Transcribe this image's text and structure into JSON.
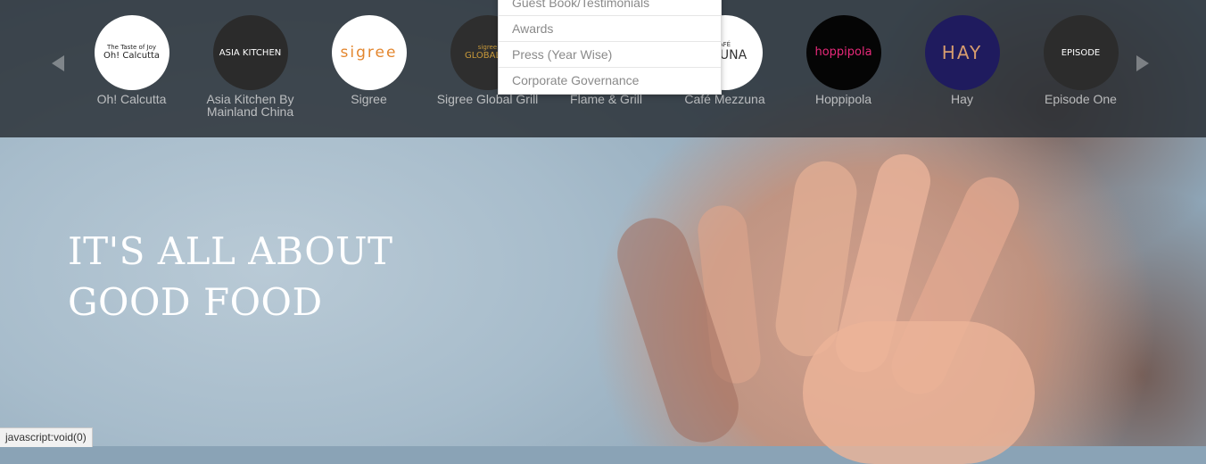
{
  "brands": [
    {
      "name": "Oh! Calcutta",
      "logo_text": "Oh! Calcutta",
      "logo_sub": "The Taste of Joy",
      "logo_bg": "#ffffff",
      "logo_fg": "#222222",
      "icon": "oh-calcutta-logo"
    },
    {
      "name": "Asia Kitchen By Mainland China",
      "logo_text": "ASIA KITCHEN",
      "logo_sub": "",
      "logo_bg": "#2b2b2b",
      "logo_fg": "#ffffff",
      "icon": "asia-kitchen-logo"
    },
    {
      "name": "Sigree",
      "logo_text": "sigree",
      "logo_sub": "",
      "logo_bg": "#ffffff",
      "logo_fg": "#e3862e",
      "icon": "sigree-logo"
    },
    {
      "name": "Sigree Global Grill",
      "logo_text": "GLOBAL G",
      "logo_sub": "sigree",
      "logo_bg": "#2e2e2e",
      "logo_fg": "#c99a3a",
      "icon": "sigree-global-grill-logo"
    },
    {
      "name": "Flame & Grill",
      "logo_text": "",
      "logo_sub": "",
      "logo_bg": "#3a3a3a",
      "logo_fg": "#ffffff",
      "icon": "flame-grill-logo"
    },
    {
      "name": "Café Mezzuna",
      "logo_text": "ZZUNA",
      "logo_sub": "AFÉ",
      "logo_bg": "#ffffff",
      "logo_fg": "#333333",
      "icon": "cafe-mezzuna-logo"
    },
    {
      "name": "Hoppipola",
      "logo_text": "hoppipola",
      "logo_sub": "",
      "logo_bg": "#050505",
      "logo_fg": "#e8297a",
      "icon": "hoppipola-logo"
    },
    {
      "name": "Hay",
      "logo_text": "HAY",
      "logo_sub": "",
      "logo_bg": "#1f1b5e",
      "logo_fg": "#d79d6e",
      "icon": "hay-logo"
    },
    {
      "name": "Episode One",
      "logo_text": "EPISODE",
      "logo_sub": "",
      "logo_bg": "#2c2c2c",
      "logo_fg": "#ffffff",
      "icon": "episode-one-logo"
    }
  ],
  "carousel": {
    "prev_icon": "chevron-left-icon",
    "next_icon": "chevron-right-icon"
  },
  "dropdown": {
    "items": [
      "Guest Book/Testimonials",
      "Awards",
      "Press (Year Wise)",
      "Corporate Governance"
    ]
  },
  "hero": {
    "line1": "IT'S ALL ABOUT",
    "line2": "GOOD FOOD"
  },
  "status_bar": {
    "text": "javascript:void(0)"
  }
}
